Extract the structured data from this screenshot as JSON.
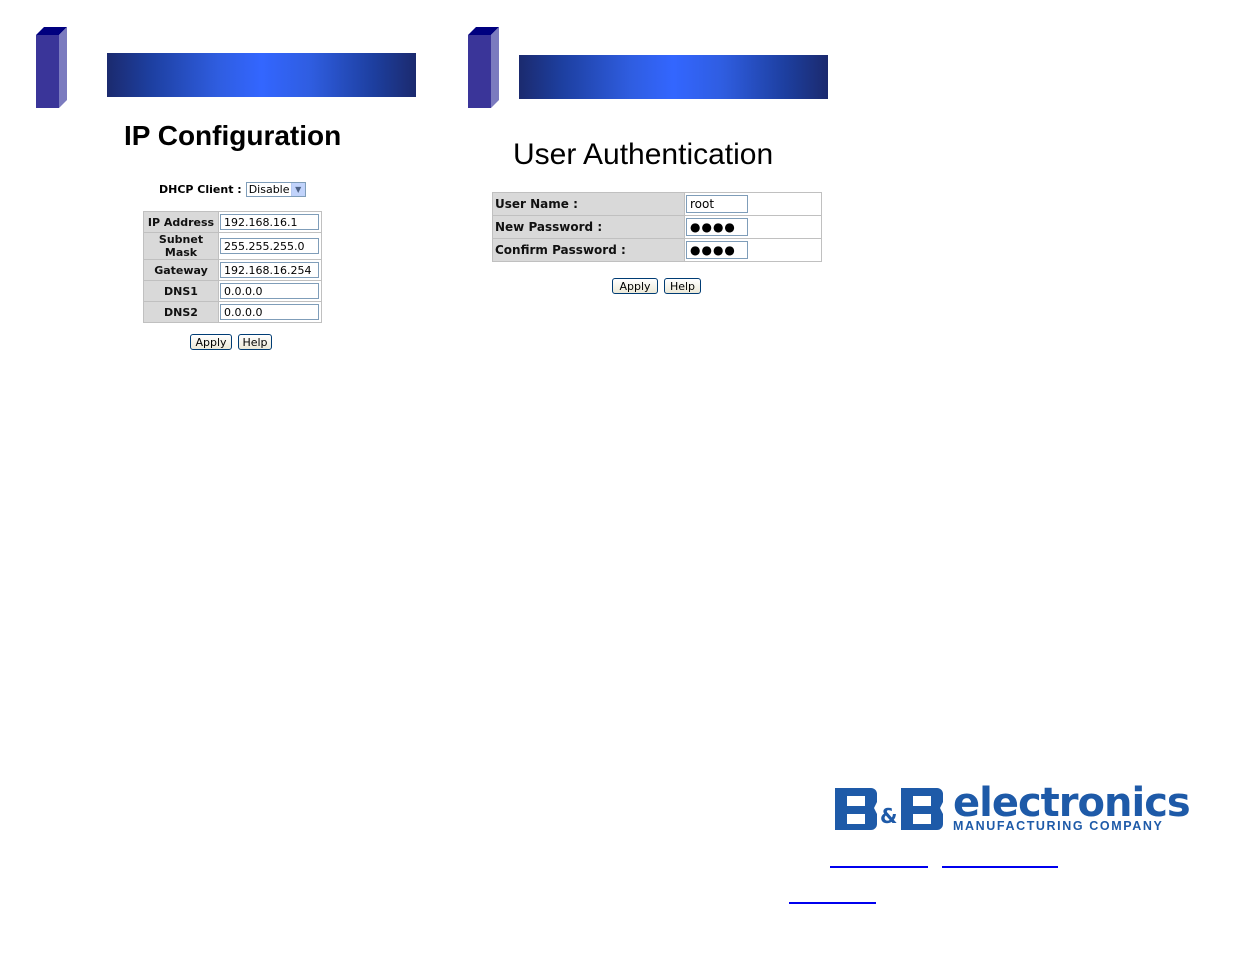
{
  "left_panel": {
    "title": "IP Configuration",
    "dhcp": {
      "label": "DHCP Client :",
      "selected": "Disable",
      "arrow_icon": "chevron-down-icon"
    },
    "fields": [
      {
        "label": "IP Address",
        "value": "192.168.16.1"
      },
      {
        "label": "Subnet Mask",
        "value": "255.255.255.0"
      },
      {
        "label": "Gateway",
        "value": "192.168.16.254"
      },
      {
        "label": "DNS1",
        "value": "0.0.0.0"
      },
      {
        "label": "DNS2",
        "value": "0.0.0.0"
      }
    ],
    "buttons": {
      "apply": "Apply",
      "help": "Help"
    }
  },
  "right_panel": {
    "title": "User Authentication",
    "fields": [
      {
        "label": "User Name :",
        "value": "root"
      },
      {
        "label": "New Password :",
        "value": "●●●●"
      },
      {
        "label": "Confirm Password :",
        "value": "●●●●"
      }
    ],
    "buttons": {
      "apply": "Apply",
      "help": "Help"
    }
  },
  "logo": {
    "mark": "B&B",
    "word": "electronics",
    "tagline": "MANUFACTURING COMPANY",
    "color": "#1e5aa8"
  },
  "colors": {
    "banner_mid": "#3366ff",
    "banner_edge": "#1b2a6e",
    "block_front": "#3a3599",
    "block_side": "#7b7bbf",
    "block_top": "#00007f",
    "link": "#0000ee"
  }
}
